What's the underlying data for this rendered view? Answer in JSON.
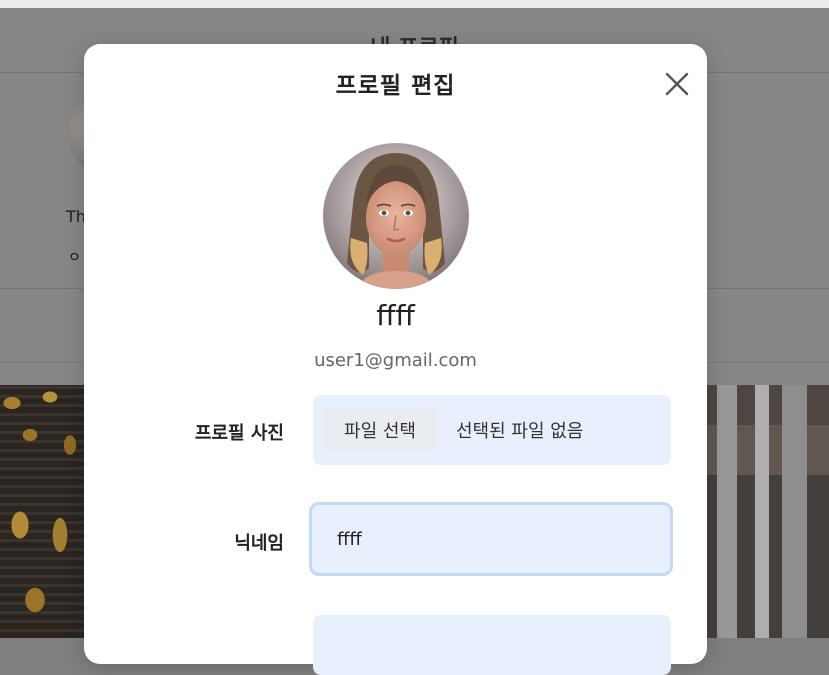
{
  "background": {
    "title": "내 프로필",
    "bio_fragment": "Th",
    "bullet": "ㅇ"
  },
  "modal": {
    "title": "프로필 편집",
    "close_icon": "close-icon",
    "display_name": "ffff",
    "email": "user1@gmail.com",
    "profile_photo": {
      "label": "프로필 사진",
      "button_label": "파일 선택",
      "status": "선택된 파일 없음"
    },
    "nickname": {
      "label": "닉네임",
      "value": "ffff"
    }
  },
  "colors": {
    "input_bg": "#e8f0fd",
    "focus_border": "#c2d9f7"
  }
}
